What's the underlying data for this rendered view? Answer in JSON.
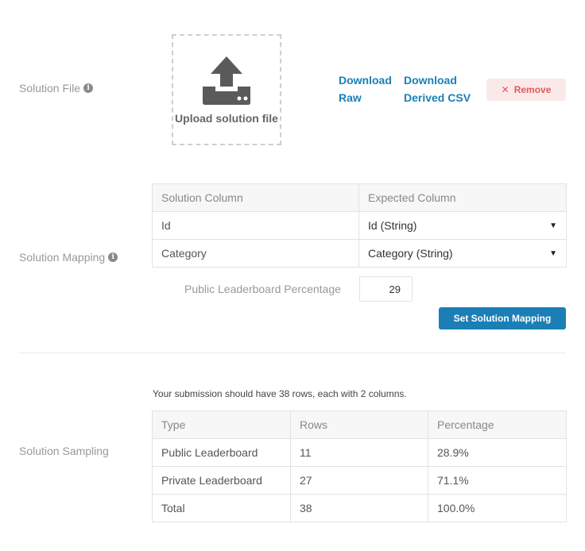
{
  "solution_file": {
    "label": "Solution File",
    "info_icon": "info-icon",
    "upload_label": "Upload solution file",
    "upload_icon": "upload-icon",
    "download_raw": "Download Raw",
    "download_derived_csv": "Download Derived CSV",
    "remove_label": "Remove"
  },
  "solution_mapping": {
    "label": "Solution Mapping",
    "headers": [
      "Solution Column",
      "Expected Column"
    ],
    "rows": [
      {
        "solution_column": "Id",
        "expected_column": "Id (String)"
      },
      {
        "solution_column": "Category",
        "expected_column": "Category (String)"
      }
    ],
    "public_leaderboard_label": "Public Leaderboard Percentage",
    "public_leaderboard_value": "29",
    "set_button_label": "Set Solution Mapping"
  },
  "solution_sampling": {
    "label": "Solution Sampling",
    "note": "Your submission should have 38 rows, each with 2 columns.",
    "headers": [
      "Type",
      "Rows",
      "Percentage"
    ],
    "rows": [
      {
        "type": "Public Leaderboard",
        "rows": "11",
        "percentage": "28.9%"
      },
      {
        "type": "Private Leaderboard",
        "rows": "27",
        "percentage": "71.1%"
      },
      {
        "type": "Total",
        "rows": "38",
        "percentage": "100.0%"
      }
    ]
  },
  "colors": {
    "link": "#1b7fb5",
    "primary_button": "#1b7fb5",
    "remove_bg": "#fbe9e9",
    "remove_text": "#e05a5a"
  }
}
